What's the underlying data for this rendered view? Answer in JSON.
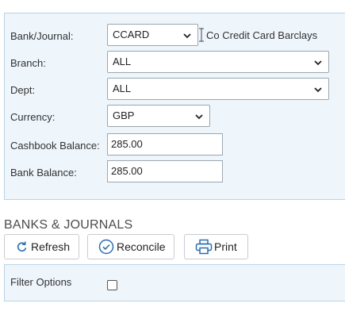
{
  "form": {
    "bank_journal": {
      "label": "Bank/Journal:",
      "value": "CCARD",
      "description": "Co Credit Card Barclays"
    },
    "branch": {
      "label": "Branch:",
      "value": "ALL"
    },
    "dept": {
      "label": "Dept:",
      "value": "ALL"
    },
    "currency": {
      "label": "Currency:",
      "value": "GBP"
    },
    "cashbook_balance": {
      "label": "Cashbook Balance:",
      "value": "285.00"
    },
    "bank_balance": {
      "label": "Bank Balance:",
      "value": "285.00"
    }
  },
  "section": {
    "title": "BANKS & JOURNALS"
  },
  "toolbar": {
    "refresh_label": "Refresh",
    "reconcile_label": "Reconcile",
    "print_label": "Print"
  },
  "filter": {
    "label": "Filter Options",
    "checked": false
  },
  "icons": {
    "refresh": "refresh-icon",
    "reconcile": "check-circle-icon",
    "print": "printer-icon"
  },
  "colors": {
    "accent": "#2a6fb0",
    "panel_bg": "#eef5fb",
    "panel_border": "#b9d4e7"
  }
}
